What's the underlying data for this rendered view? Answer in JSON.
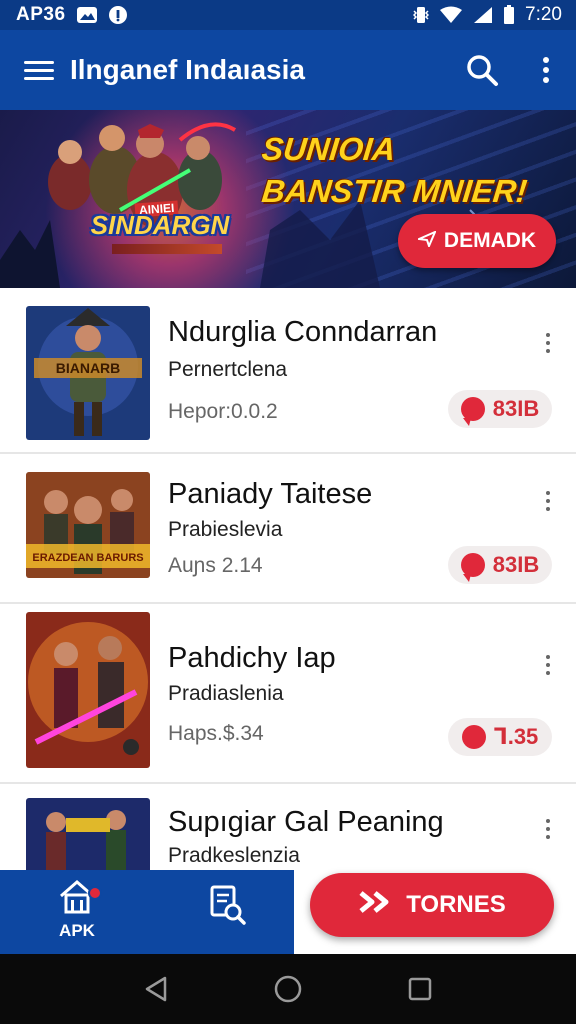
{
  "status_bar": {
    "left_text": "AP36",
    "time": "7:20",
    "icons": [
      "image-icon",
      "info-icon",
      "vibrate-icon",
      "wifi-icon",
      "signal-icon",
      "battery-icon"
    ]
  },
  "app_bar": {
    "title": "Ilnganef Indaıasia",
    "icons": [
      "menu-icon",
      "search-icon",
      "more-vert-icon"
    ]
  },
  "banner": {
    "headline_line1": "SUNIOIA",
    "headline_line2": "BANSTIR MNIER!",
    "logo_top": "AINIEI",
    "logo_text": "SINDARGN",
    "cta_label": "DEMADK",
    "colors": {
      "headline": "#ffd21c",
      "cta": "#e0283a"
    }
  },
  "apps": [
    {
      "name": "Ndurglia Conndarran",
      "developer": "Pernertclena",
      "meta": "Hepor:0.0.2",
      "badge": "83IB",
      "badge_icon": "chat-bubble-icon",
      "thumb_caption": "BIANARB"
    },
    {
      "name": "Paniady Taitese",
      "developer": "Prabieslevia",
      "meta": "Auɲs 2.14",
      "badge": "83IB",
      "badge_icon": "chat-bubble-icon",
      "thumb_caption": "ERAZDEAN BARURS"
    },
    {
      "name": "Pahdichy Iap",
      "developer": "Pradiaslenia",
      "meta": "Haps.$.34",
      "badge": "Ꞁ.35",
      "badge_icon": "record-icon",
      "thumb_caption": ""
    },
    {
      "name": "Supıgiar Gal Peaning",
      "developer": "Pradkeslenzia",
      "meta": "",
      "badge": "",
      "badge_icon": "",
      "thumb_caption": ""
    }
  ],
  "bottom_nav": {
    "home_label": "APK",
    "fab_label": "TORNES",
    "icons": [
      "home-icon",
      "doc-search-icon",
      "double-chevron-icon"
    ],
    "colors": {
      "left_panel": "#0d47a1",
      "fab": "#e0283a"
    }
  },
  "system_nav": {
    "icons": [
      "back-icon",
      "home-circle-icon",
      "recents-icon"
    ]
  }
}
